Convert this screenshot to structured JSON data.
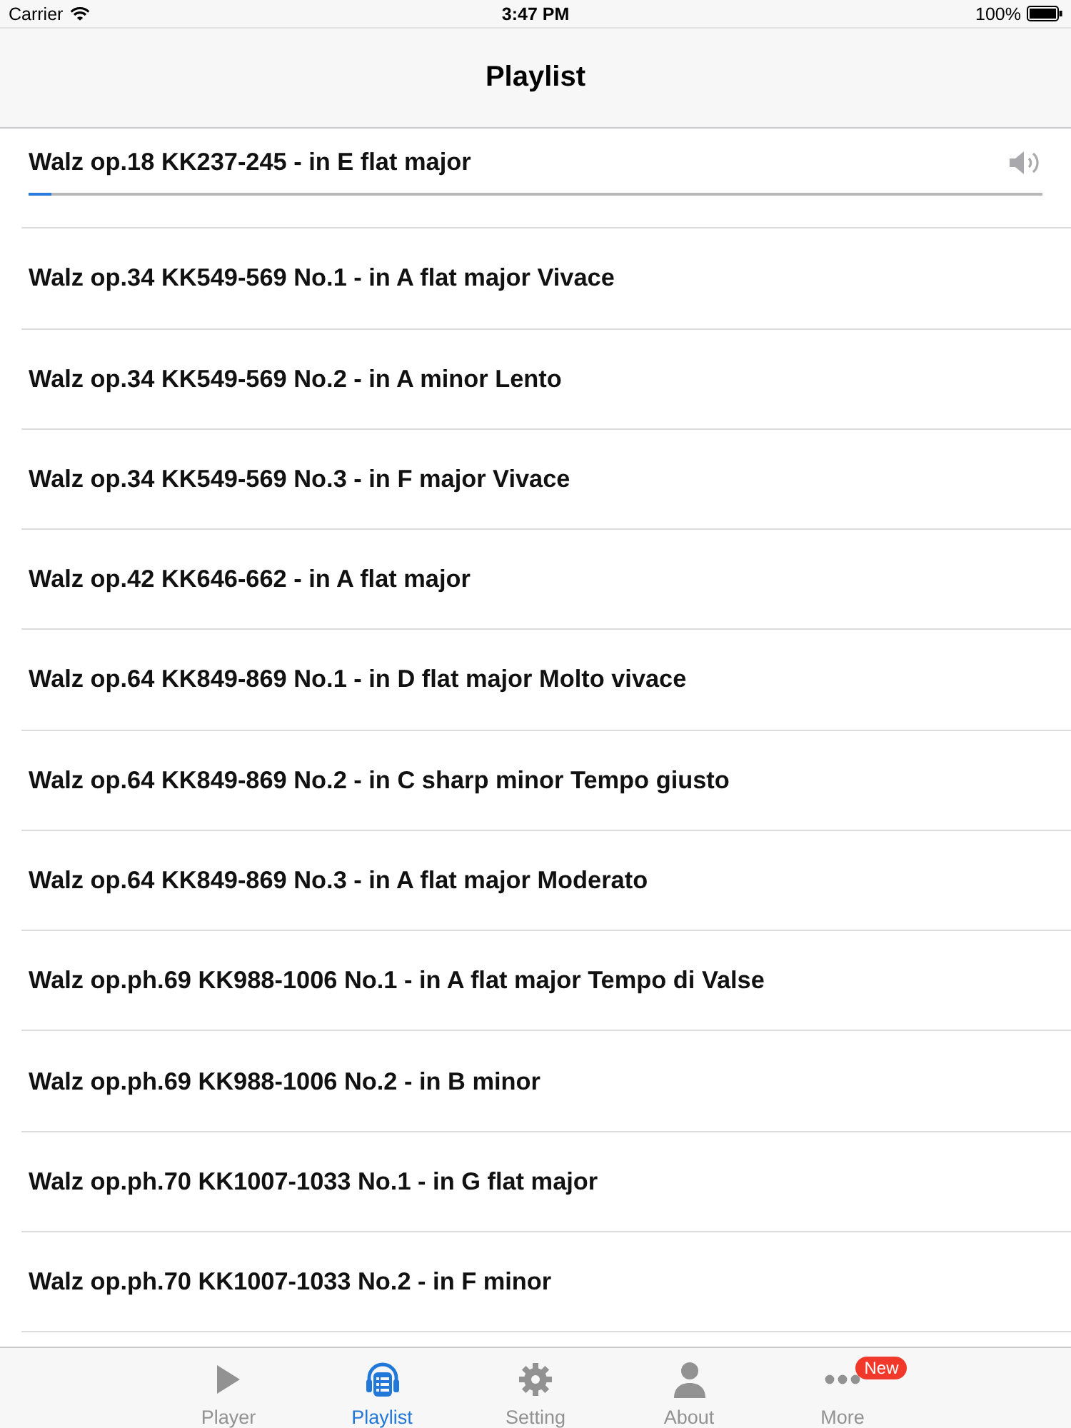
{
  "status_bar": {
    "carrier": "Carrier",
    "time": "3:47 PM",
    "battery": "100%"
  },
  "nav_bar": {
    "title": "Playlist"
  },
  "playlist": [
    {
      "title": "Walz op.18 KK237-245 - in E flat major",
      "playing": true,
      "level": 0.022
    },
    {
      "title": "Walz op.34 KK549-569 No.1 - in A flat major Vivace",
      "playing": false
    },
    {
      "title": "Walz op.34 KK549-569 No.2 - in A minor Lento",
      "playing": false
    },
    {
      "title": "Walz op.34 KK549-569 No.3 - in F major Vivace",
      "playing": false
    },
    {
      "title": "Walz op.42 KK646-662 - in A flat major",
      "playing": false
    },
    {
      "title": "Walz op.64 KK849-869 No.1 - in D flat major Molto vivace",
      "playing": false
    },
    {
      "title": "Walz op.64 KK849-869 No.2 - in C sharp minor Tempo giusto",
      "playing": false
    },
    {
      "title": "Walz op.64 KK849-869 No.3 - in A flat major Moderato",
      "playing": false
    },
    {
      "title": "Walz op.ph.69 KK988-1006 No.1 - in A flat major Tempo di Valse",
      "playing": false
    },
    {
      "title": "Walz op.ph.69 KK988-1006 No.2 - in B minor",
      "playing": false
    },
    {
      "title": "Walz op.ph.70 KK1007-1033 No.1 - in G flat major",
      "playing": false
    },
    {
      "title": "Walz op.ph.70 KK1007-1033 No.2 - in F minor",
      "playing": false
    }
  ],
  "tab_bar": {
    "tabs": [
      {
        "kind": "play",
        "label": "Player",
        "selected": false
      },
      {
        "kind": "playlist",
        "label": "Playlist",
        "selected": true
      },
      {
        "kind": "gear",
        "label": "Setting",
        "selected": false
      },
      {
        "kind": "person",
        "label": "About",
        "selected": false
      },
      {
        "kind": "more",
        "label": "More",
        "selected": false,
        "badge": "New"
      }
    ]
  }
}
